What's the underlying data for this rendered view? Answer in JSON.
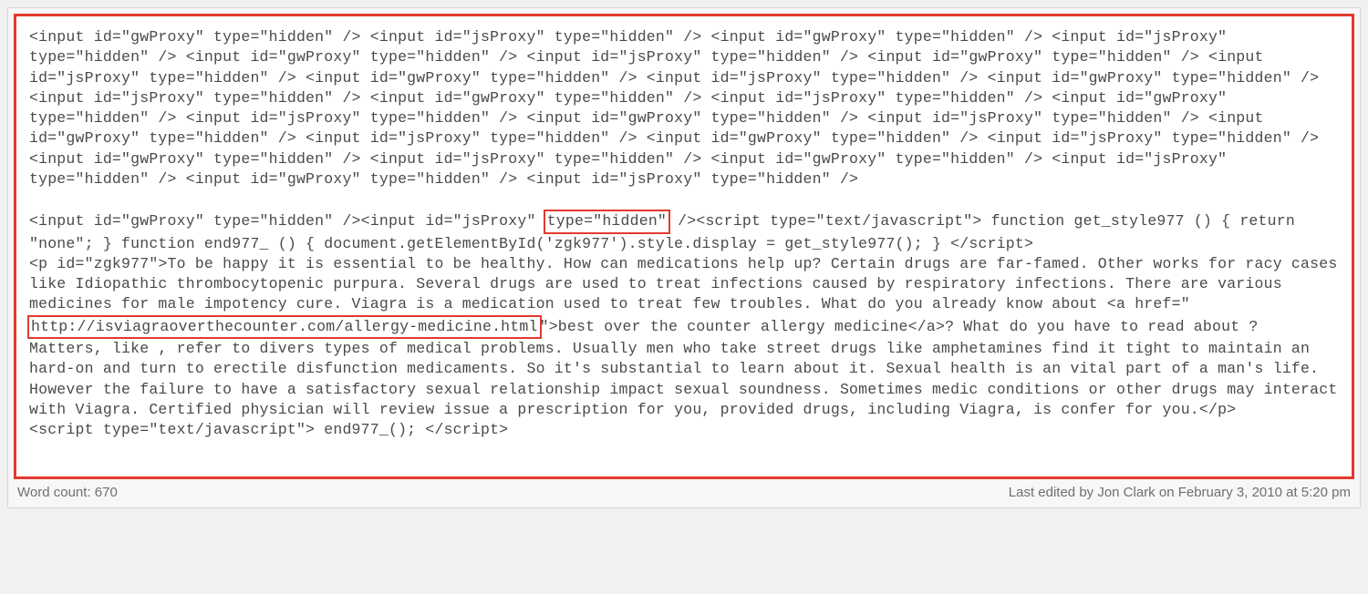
{
  "colors": {
    "highlight_border": "#e33a2e"
  },
  "code": {
    "block1": "<input id=\"gwProxy\" type=\"hidden\" /> <input id=\"jsProxy\" type=\"hidden\" /> <input id=\"gwProxy\" type=\"hidden\" /> <input id=\"jsProxy\" type=\"hidden\" /> <input id=\"gwProxy\" type=\"hidden\" /> <input id=\"jsProxy\" type=\"hidden\" /> <input id=\"gwProxy\" type=\"hidden\" /> <input id=\"jsProxy\" type=\"hidden\" /> <input id=\"gwProxy\" type=\"hidden\" /> <input id=\"jsProxy\" type=\"hidden\" /> <input id=\"gwProxy\" type=\"hidden\" /> <input id=\"jsProxy\" type=\"hidden\" /> <input id=\"gwProxy\" type=\"hidden\" /> <input id=\"jsProxy\" type=\"hidden\" /> <input id=\"gwProxy\" type=\"hidden\" /> <input id=\"jsProxy\" type=\"hidden\" /> <input id=\"gwProxy\" type=\"hidden\" /> <input id=\"jsProxy\" type=\"hidden\" /> <input id=\"gwProxy\" type=\"hidden\" /> <input id=\"jsProxy\" type=\"hidden\" /> <input id=\"gwProxy\" type=\"hidden\" /> <input id=\"jsProxy\" type=\"hidden\" /> <input id=\"gwProxy\" type=\"hidden\" /> <input id=\"jsProxy\" type=\"hidden\" /> <input id=\"gwProxy\" type=\"hidden\" /> <input id=\"jsProxy\" type=\"hidden\" /> <input id=\"gwProxy\" type=\"hidden\" /> <input id=\"jsProxy\" type=\"hidden\" />",
    "block2_seg1": "<input id=\"gwProxy\" type=\"hidden\" /><input id=\"jsProxy\" ",
    "block2_hl1": "type=\"hidden\"",
    "block2_seg2": " /><script type=\"text/javascript\"> function get_style977 () { return \"none\"; } function end977_ () { document.getElementById('zgk977').style.display = get_style977(); } </script>\n<p id=\"zgk977\">To be happy it is essential to be healthy. How can medications help up? Certain drugs are far-famed. Other works for racy cases like Idiopathic thrombocytopenic purpura. Several drugs are used to treat infections caused by respiratory infections. There are various medicines for male impotency cure. Viagra is a medication used to treat few troubles. What do you already know about <a href=\"",
    "block2_hl2": "http://isviagraoverthecounter.com/allergy-medicine.html",
    "block2_seg3": "\">best over the counter allergy medicine</a>? What do you have to read about ? Matters, like , refer to divers types of medical problems. Usually men who take street drugs like amphetamines find it tight to maintain an hard-on and turn to erectile disfunction medicaments. So it's substantial to learn about it. Sexual health is an vital part of a man's life. However the failure to have a satisfactory sexual relationship impact sexual soundness. Sometimes medic conditions or other drugs may interact with Viagra. Certified physician will review issue a prescription for you, provided drugs, including Viagra, is confer for you.</p>\n<script type=\"text/javascript\"> end977_(); </script>"
  },
  "footer": {
    "word_count_label": "Word count: 670",
    "last_edited_label": "Last edited by Jon Clark on February 3, 2010 at 5:20 pm"
  }
}
